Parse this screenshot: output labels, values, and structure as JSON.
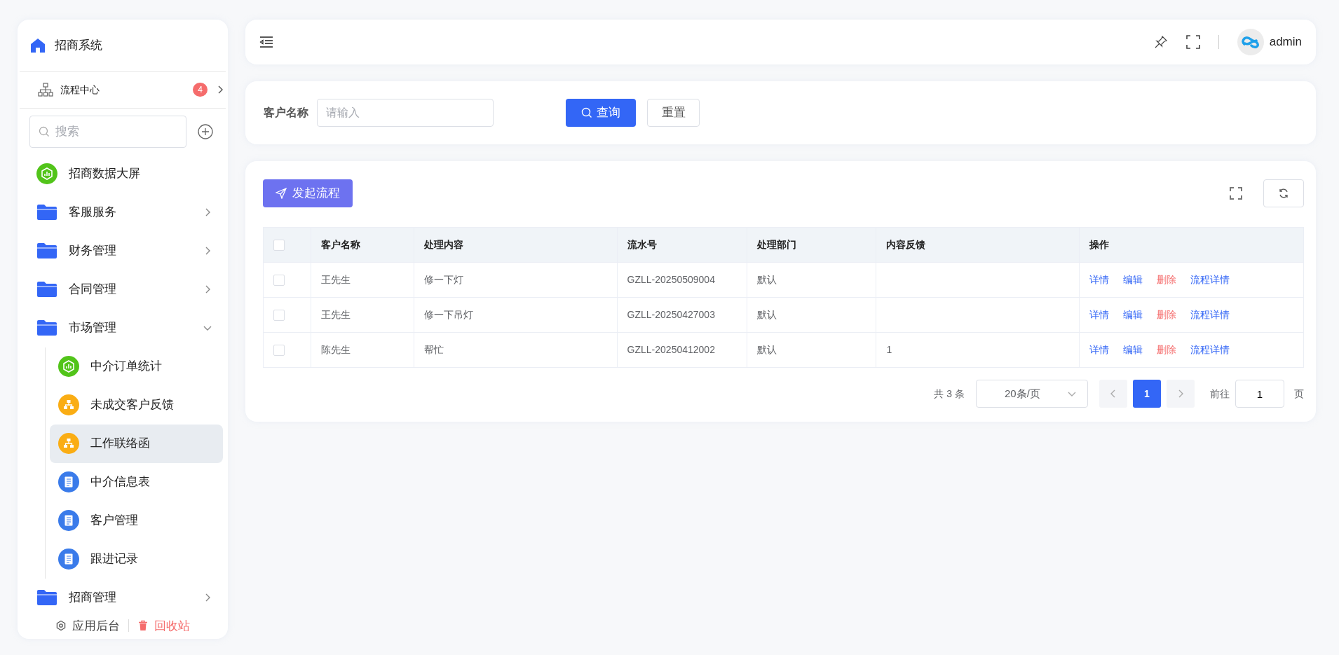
{
  "app": {
    "title": "招商系统"
  },
  "process_center": {
    "label": "流程中心",
    "badge": "4"
  },
  "sidebar_search": {
    "placeholder": "搜索"
  },
  "menu": [
    {
      "label": "招商数据大屏",
      "kind": "chart",
      "selected": false
    },
    {
      "label": "客服服务",
      "kind": "folder",
      "expanded": false,
      "selected": false
    },
    {
      "label": "财务管理",
      "kind": "folder",
      "expanded": false,
      "selected": false
    },
    {
      "label": "合同管理",
      "kind": "folder",
      "expanded": false,
      "selected": false
    },
    {
      "label": "市场管理",
      "kind": "folder",
      "expanded": true,
      "selected": false,
      "children": [
        {
          "label": "中介订单统计",
          "kind": "chart",
          "selected": false
        },
        {
          "label": "未成交客户反馈",
          "kind": "flow",
          "selected": false
        },
        {
          "label": "工作联络函",
          "kind": "flow",
          "selected": true
        },
        {
          "label": "中介信息表",
          "kind": "doc",
          "selected": false
        },
        {
          "label": "客户管理",
          "kind": "doc",
          "selected": false
        },
        {
          "label": "跟进记录",
          "kind": "doc",
          "selected": false
        }
      ]
    },
    {
      "label": "招商管理",
      "kind": "folder",
      "expanded": false,
      "selected": false
    }
  ],
  "sidebar_footer": [
    {
      "label": "应用后台",
      "kind": "settings"
    },
    {
      "label": "回收站",
      "kind": "trash"
    }
  ],
  "topbar": {
    "user": "admin"
  },
  "filter": {
    "label": "客户名称",
    "placeholder": "请输入",
    "search_button": "查询",
    "reset_button": "重置"
  },
  "toolbar": {
    "start_button": "发起流程"
  },
  "table": {
    "all_checked": false,
    "columns": [
      "客户名称",
      "处理内容",
      "流水号",
      "处理部门",
      "内容反馈",
      "操作"
    ],
    "rows": [
      {
        "checked": false,
        "cells": [
          "王先生",
          "修一下灯",
          "GZLL-20250509004",
          "默认",
          ""
        ],
        "actions": [
          {
            "label": "详情",
            "kind": "link"
          },
          {
            "label": "编辑",
            "kind": "link"
          },
          {
            "label": "删除",
            "kind": "danger"
          },
          {
            "label": "流程详情",
            "kind": "link"
          }
        ]
      },
      {
        "checked": false,
        "cells": [
          "王先生",
          "修一下吊灯",
          "GZLL-20250427003",
          "默认",
          ""
        ],
        "actions": [
          {
            "label": "详情",
            "kind": "link"
          },
          {
            "label": "编辑",
            "kind": "link"
          },
          {
            "label": "删除",
            "kind": "danger"
          },
          {
            "label": "流程详情",
            "kind": "link"
          }
        ]
      },
      {
        "checked": false,
        "cells": [
          "陈先生",
          "帮忙",
          "GZLL-20250412002",
          "默认",
          "1"
        ],
        "actions": [
          {
            "label": "详情",
            "kind": "link"
          },
          {
            "label": "编辑",
            "kind": "link"
          },
          {
            "label": "删除",
            "kind": "danger"
          },
          {
            "label": "流程详情",
            "kind": "link"
          }
        ]
      }
    ]
  },
  "pagination": {
    "total": "共 3 条",
    "page_size": "20条/页",
    "pages": [
      {
        "label": "1",
        "selected": true
      }
    ],
    "goto_label": "前往",
    "goto_value": "1",
    "page_suffix": "页"
  }
}
